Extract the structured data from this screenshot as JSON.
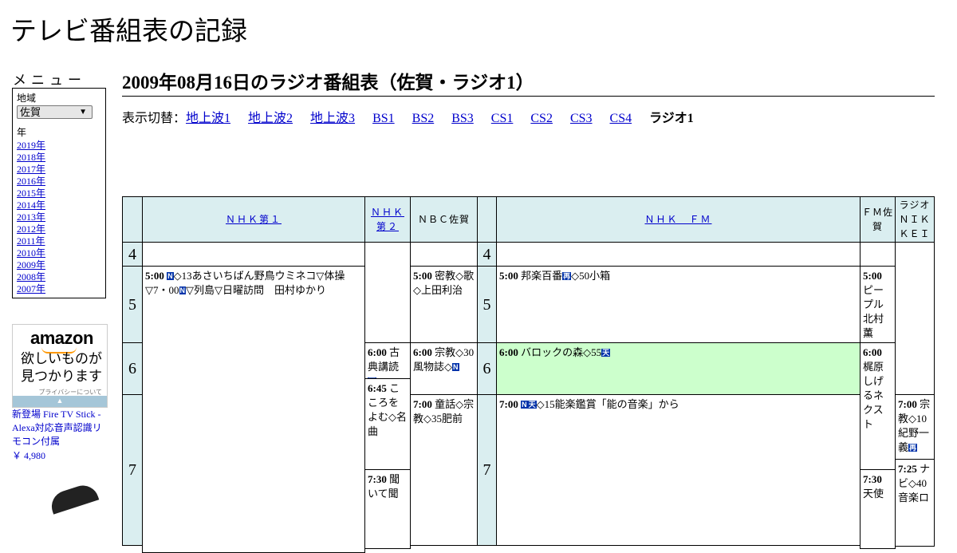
{
  "site_title": "テレビ番組表の記録",
  "menu": {
    "title": "メニュー",
    "region_label": "地域",
    "region_value": "佐賀",
    "year_label": "年",
    "years": [
      "2019年",
      "2018年",
      "2017年",
      "2016年",
      "2015年",
      "2014年",
      "2013年",
      "2012年",
      "2011年",
      "2010年",
      "2009年",
      "2008年",
      "2007年"
    ]
  },
  "ad": {
    "brand": "amazon",
    "tagline_1": "欲しいものが",
    "tagline_2": "見つかります",
    "privacy": "プライバシーについて",
    "product_text": "新登場 Fire TV Stick - Alexa対応音声認識リモコン付属",
    "price": "￥ 4,980"
  },
  "page_heading": "2009年08月16日のラジオ番組表（佐賀・ラジオ1）",
  "switcher": {
    "prefix": "表示切替：",
    "links": [
      "地上波1",
      "地上波2",
      "地上波3",
      "BS1",
      "BS2",
      "BS3",
      "CS1",
      "CS2",
      "CS3",
      "CS4"
    ],
    "current": "ラジオ1"
  },
  "channels": {
    "nhk1": "ＮＨＫ第１",
    "nhk2": "ＮＨＫ第２",
    "nbc": "ＮＢＣ佐賀",
    "nhkfm": "ＮＨＫ　ＦＭ",
    "fmsaga": "ＦＭ佐賀",
    "nikkei": "ラジオＮＩＫＫＥＩ"
  },
  "hours": [
    "4",
    "5",
    "6",
    "7"
  ],
  "programs": {
    "nhk1_500_time": "5:00",
    "nhk1_500_text_a": "◇13あさいちばん野鳥ウミネコ▽体操▽7・00",
    "nhk1_500_text_b": "▽列島▽日曜訪問　田村ゆかり",
    "nhk2_600_time": "6:00",
    "nhk2_600_text": "古典講読",
    "nhk2_645_time": "6:45",
    "nhk2_645_text": "こころをよむ◇名曲",
    "nhk2_730_time": "7:30",
    "nhk2_730_text": "聞いて聞",
    "nbc_500_time": "5:00",
    "nbc_500_text": "密教◇歌◇上田利治",
    "nbc_600_time": "6:00",
    "nbc_600_text": "宗教◇30風物誌◇",
    "nbc_700_time": "7:00",
    "nbc_700_text": "童話◇宗教◇35肥前",
    "fm_500_time": "5:00",
    "fm_500_text": "邦楽百番",
    "fm_500_text_b": "◇50小箱",
    "fm_600_time": "6:00",
    "fm_600_text": "バロックの森◇55",
    "fm_700_time": "7:00",
    "fm_700_text": "◇15能楽鑑賞「能の音楽」から",
    "fmsaga_500_time": "5:00",
    "fmsaga_500_text": "ピープル北村薫",
    "fmsaga_600_time": "6:00",
    "fmsaga_600_text": "梶原しげるネクスト",
    "fmsaga_730_time": "7:30",
    "fmsaga_730_text": "天使",
    "nikkei_700_time": "7:00",
    "nikkei_700_text": "宗教◇10紀野一義",
    "nikkei_725_time": "7:25",
    "nikkei_725_text": "ナビ◇40音楽ロ"
  },
  "badges": {
    "news": "N",
    "weather": "天",
    "rebroadcast": "再"
  },
  "colors": {
    "header_bg": "#daeef0",
    "highlight": "#ccffcc",
    "link": "#0000cc",
    "badge": "#0033aa"
  }
}
